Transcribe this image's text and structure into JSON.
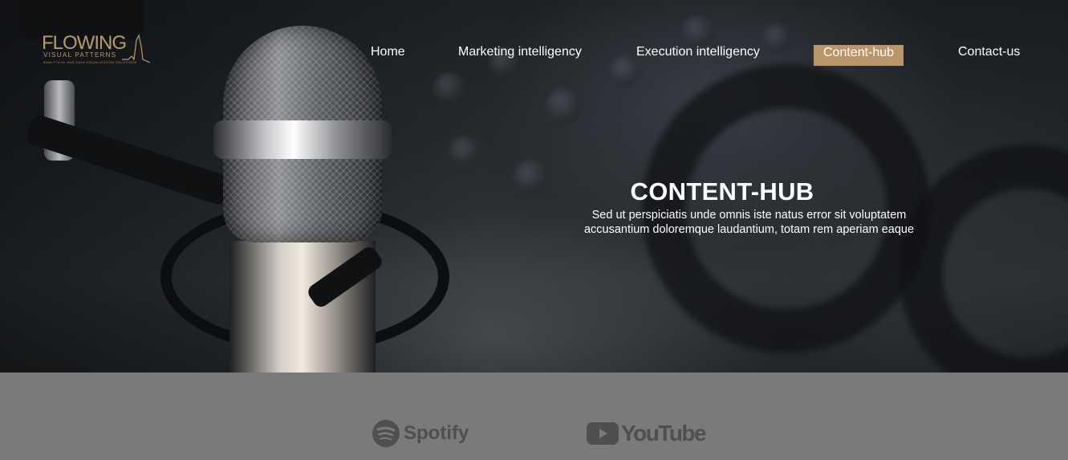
{
  "logo": {
    "title": "FLOWING",
    "subtitle": "VISUAL PATTERNS",
    "tagline": "ANALYTICAL AND DATA VISUALIZATION SOLUTIONS"
  },
  "nav": {
    "items": [
      {
        "label": "Home",
        "active": false
      },
      {
        "label": "Marketing intelligency",
        "active": false
      },
      {
        "label": "Execution intelligency",
        "active": false
      },
      {
        "label": "Content-hub",
        "active": true
      },
      {
        "label": "Contact-us",
        "active": false
      }
    ]
  },
  "hero": {
    "title": "CONTENT-HUB",
    "description": "Sed ut perspiciatis unde omnis iste natus error sit voluptatem accusantium doloremque laudantium, totam rem aperiam eaque"
  },
  "brands": [
    {
      "name": "Spotify",
      "icon": "spotify-icon"
    },
    {
      "name": "YouTube",
      "icon": "youtube-icon"
    }
  ],
  "colors": {
    "accent": "#b8966a",
    "strip_bg": "#7a7a7a",
    "brand_gray": "#4f4f4f"
  }
}
